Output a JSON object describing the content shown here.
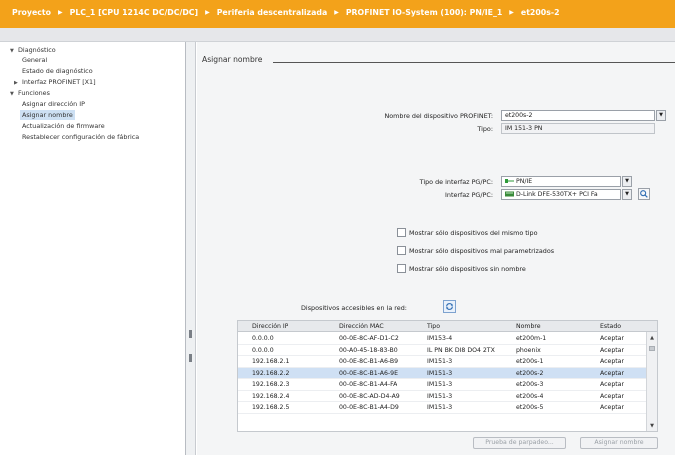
{
  "breadcrumb": [
    "Proyecto",
    "PLC_1 [CPU 1214C DC/DC/DC]",
    "Periferia descentralizada",
    "PROFINET IO-System (100): PN/IE_1",
    "et200s-2"
  ],
  "colors": {
    "header": "#f3a21a",
    "selection": "#cde0f3"
  },
  "nav": {
    "items": [
      {
        "label": "Diagnóstico",
        "indent": 0,
        "toggle": "▼"
      },
      {
        "label": "General",
        "indent": 1,
        "toggle": ""
      },
      {
        "label": "Estado de diagnóstico",
        "indent": 1,
        "toggle": ""
      },
      {
        "label": "Interfaz PROFINET [X1]",
        "indent": 1,
        "toggle": "▶"
      },
      {
        "label": "Funciones",
        "indent": 0,
        "toggle": "▼"
      },
      {
        "label": "Asignar dirección IP",
        "indent": 1,
        "toggle": ""
      },
      {
        "label": "Asignar nombre",
        "indent": 1,
        "toggle": "",
        "active": true
      },
      {
        "label": "Actualización de firmware",
        "indent": 1,
        "toggle": ""
      },
      {
        "label": "Restablecer configuración de fábrica",
        "indent": 1,
        "toggle": ""
      }
    ]
  },
  "main": {
    "section_title": "Asignar nombre",
    "device_name_label": "Nombre del dispositivo PROFINET:",
    "device_name_value": "et200s-2",
    "type_label": "Tipo:",
    "type_value": "IM 151-3 PN",
    "pgpc_type_label": "Tipo de interfaz PG/PC:",
    "pgpc_type_value": "PN/IE",
    "pgpc_interface_label": "Interfaz PG/PC:",
    "pgpc_interface_value": "D-Link DFE-530TX+ PCI Fa",
    "checkboxes": [
      "Mostrar sólo dispositivos del mismo tipo",
      "Mostrar sólo dispositivos mal parametrizados",
      "Mostrar sólo dispositivos sin nombre"
    ],
    "devices_label": "Dispositivos accesibles en la red:",
    "table": {
      "headers": [
        "Dirección IP",
        "Dirección MAC",
        "Tipo",
        "Nombre",
        "Estado"
      ],
      "rows": [
        [
          "0.0.0.0",
          "00-0E-8C-AF-D1-C2",
          "IM153-4",
          "et200m-1",
          "Aceptar"
        ],
        [
          "0.0.0.0",
          "00-A0-45-18-83-B0",
          "IL PN BK DI8 DO4 2TX",
          "phoenix",
          "Aceptar"
        ],
        [
          "192.168.2.1",
          "00-0E-8C-B1-A6-B9",
          "IM151-3",
          "et200s-1",
          "Aceptar"
        ],
        [
          "192.168.2.2",
          "00-0E-8C-B1-A6-9E",
          "IM151-3",
          "et200s-2",
          "Aceptar"
        ],
        [
          "192.168.2.3",
          "00-0E-8C-B1-A4-FA",
          "IM151-3",
          "et200s-3",
          "Aceptar"
        ],
        [
          "192.168.2.4",
          "00-0E-8C-AD-D4-A9",
          "IM151-3",
          "et200s-4",
          "Aceptar"
        ],
        [
          "192.168.2.5",
          "00-0E-8C-B1-A4-D9",
          "IM151-3",
          "et200s-5",
          "Aceptar"
        ]
      ],
      "selected_row": 3
    },
    "blink_button": "Prueba de parpadeo...",
    "assign_button": "Asignar nombre"
  }
}
